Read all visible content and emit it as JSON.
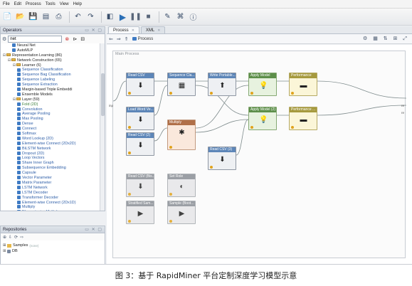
{
  "menu": [
    "File",
    "Edit",
    "Process",
    "Tools",
    "View",
    "Help"
  ],
  "toolbar": [
    "new-icon",
    "open-icon",
    "save-icon",
    "save-as-icon",
    "print-icon",
    "undo-icon",
    "redo-icon",
    "run-icon",
    "play-icon",
    "pause-icon",
    "stop-icon",
    "wizard-icon",
    "xml-icon",
    "info-icon"
  ],
  "operators_panel": {
    "title": "Operators",
    "search_value": "net",
    "tree": [
      {
        "label": "Neural Net",
        "indent": 2,
        "kind": "op"
      },
      {
        "label": "AutoMLP",
        "indent": 2,
        "kind": "op"
      },
      {
        "label": "Representation Learning (86)",
        "indent": 0,
        "kind": "folder",
        "open": true
      },
      {
        "label": "Network Construction (65)",
        "indent": 1,
        "kind": "folder",
        "open": true
      },
      {
        "label": "Learner (6)",
        "indent": 2,
        "kind": "folder",
        "open": true
      },
      {
        "label": "Sequence Classification",
        "indent": 3,
        "kind": "op",
        "color": "blue"
      },
      {
        "label": "Sequence Bag Classification",
        "indent": 3,
        "kind": "op",
        "color": "blue"
      },
      {
        "label": "Sequence Labeling",
        "indent": 3,
        "kind": "op",
        "color": "blue"
      },
      {
        "label": "Sequence Extraction",
        "indent": 3,
        "kind": "op",
        "color": "blue"
      },
      {
        "label": "Margin-based Triple Embeddi",
        "indent": 3,
        "kind": "op"
      },
      {
        "label": "Ensemble Models",
        "indent": 3,
        "kind": "op"
      },
      {
        "label": "Layer (59)",
        "indent": 2,
        "kind": "folder",
        "open": true
      },
      {
        "label": "Fold (2D)",
        "indent": 3,
        "kind": "op",
        "color": "green"
      },
      {
        "label": "Convolution",
        "indent": 3,
        "kind": "op",
        "color": "blue"
      },
      {
        "label": "Average Pooling",
        "indent": 3,
        "kind": "op",
        "color": "blue"
      },
      {
        "label": "Max Pooling",
        "indent": 3,
        "kind": "op",
        "color": "blue"
      },
      {
        "label": "Dense",
        "indent": 3,
        "kind": "op",
        "color": "blue"
      },
      {
        "label": "Connect",
        "indent": 3,
        "kind": "op",
        "color": "blue"
      },
      {
        "label": "Softmax",
        "indent": 3,
        "kind": "op",
        "color": "blue"
      },
      {
        "label": "Word Lookup (2D)",
        "indent": 3,
        "kind": "op",
        "color": "blue"
      },
      {
        "label": "Element-wise Connect (2Dx2D)",
        "indent": 3,
        "kind": "op",
        "color": "blue"
      },
      {
        "label": "BiLSTM Network",
        "indent": 3,
        "kind": "op",
        "color": "blue"
      },
      {
        "label": "Dropout (2D)",
        "indent": 3,
        "kind": "op",
        "color": "blue"
      },
      {
        "label": "Loop Vectors",
        "indent": 3,
        "kind": "op",
        "color": "blue"
      },
      {
        "label": "Share Inner Graph",
        "indent": 3,
        "kind": "op",
        "color": "blue"
      },
      {
        "label": "Subsequence Embedding",
        "indent": 3,
        "kind": "op",
        "color": "blue"
      },
      {
        "label": "Capsule",
        "indent": 3,
        "kind": "op",
        "color": "blue"
      },
      {
        "label": "Vector Parameter",
        "indent": 3,
        "kind": "op",
        "color": "blue"
      },
      {
        "label": "Matrix Parameter",
        "indent": 3,
        "kind": "op",
        "color": "blue"
      },
      {
        "label": "LSTM Network",
        "indent": 3,
        "kind": "op",
        "color": "blue"
      },
      {
        "label": "LSTM Decoder",
        "indent": 3,
        "kind": "op",
        "color": "blue"
      },
      {
        "label": "Transformer Decoder",
        "indent": 3,
        "kind": "op",
        "color": "blue"
      },
      {
        "label": "Element-wise Connect (2Dx1D)",
        "indent": 3,
        "kind": "op",
        "color": "blue"
      },
      {
        "label": "Multiply",
        "indent": 3,
        "kind": "op",
        "color": "blue"
      },
      {
        "label": "Element-wise Multiply",
        "indent": 3,
        "kind": "op",
        "color": "blue"
      }
    ]
  },
  "repositories_panel": {
    "title": "Repositories",
    "items": [
      {
        "label": "Samples",
        "note": "(none)"
      },
      {
        "label": "DB",
        "note": ""
      }
    ]
  },
  "process_panel": {
    "tabs": [
      {
        "label": "Process",
        "active": true
      },
      {
        "label": "XML",
        "active": false
      }
    ],
    "breadcrumb": "Process",
    "canvas_label": "Main Process",
    "operators": [
      {
        "id": "read_csv_1",
        "title": "Read CSV",
        "color": "default",
        "icon": "read"
      },
      {
        "id": "seq_cls",
        "title": "Sequence Cla...",
        "color": "default",
        "icon": "seq"
      },
      {
        "id": "write_portable",
        "title": "Write Portable...",
        "color": "default",
        "icon": "write"
      },
      {
        "id": "apply_model_1",
        "title": "Apply Model",
        "color": "green",
        "icon": "bulb"
      },
      {
        "id": "performance_1",
        "title": "Performance",
        "color": "yellow",
        "icon": "perf"
      },
      {
        "id": "load_word",
        "title": "Load Word Ve...",
        "color": "default",
        "icon": "load"
      },
      {
        "id": "multiply",
        "title": "Multiply",
        "color": "orange",
        "icon": "multiply"
      },
      {
        "id": "apply_model_2",
        "title": "Apply Model (2)",
        "color": "green",
        "icon": "bulb"
      },
      {
        "id": "performance_2",
        "title": "Performance ...",
        "color": "yellow",
        "icon": "perf"
      },
      {
        "id": "read_csv_2",
        "title": "Read CSV (2)",
        "color": "default",
        "icon": "read"
      },
      {
        "id": "read_csv_3",
        "title": "Read CSV (3)",
        "color": "default",
        "icon": "read"
      },
      {
        "id": "read_csv_bis",
        "title": "Read CSV (Bis...",
        "color": "gray",
        "icon": "read"
      },
      {
        "id": "set_role",
        "title": "Set Role",
        "color": "gray",
        "icon": "role"
      },
      {
        "id": "stratified",
        "title": "Stratified Sam...",
        "color": "gray",
        "icon": "sample"
      },
      {
        "id": "sample_boot",
        "title": "Sample (Boot...",
        "color": "gray",
        "icon": "sample"
      }
    ]
  },
  "caption": "图 3：基于 RapidMiner 平台定制深度学习模型示意"
}
